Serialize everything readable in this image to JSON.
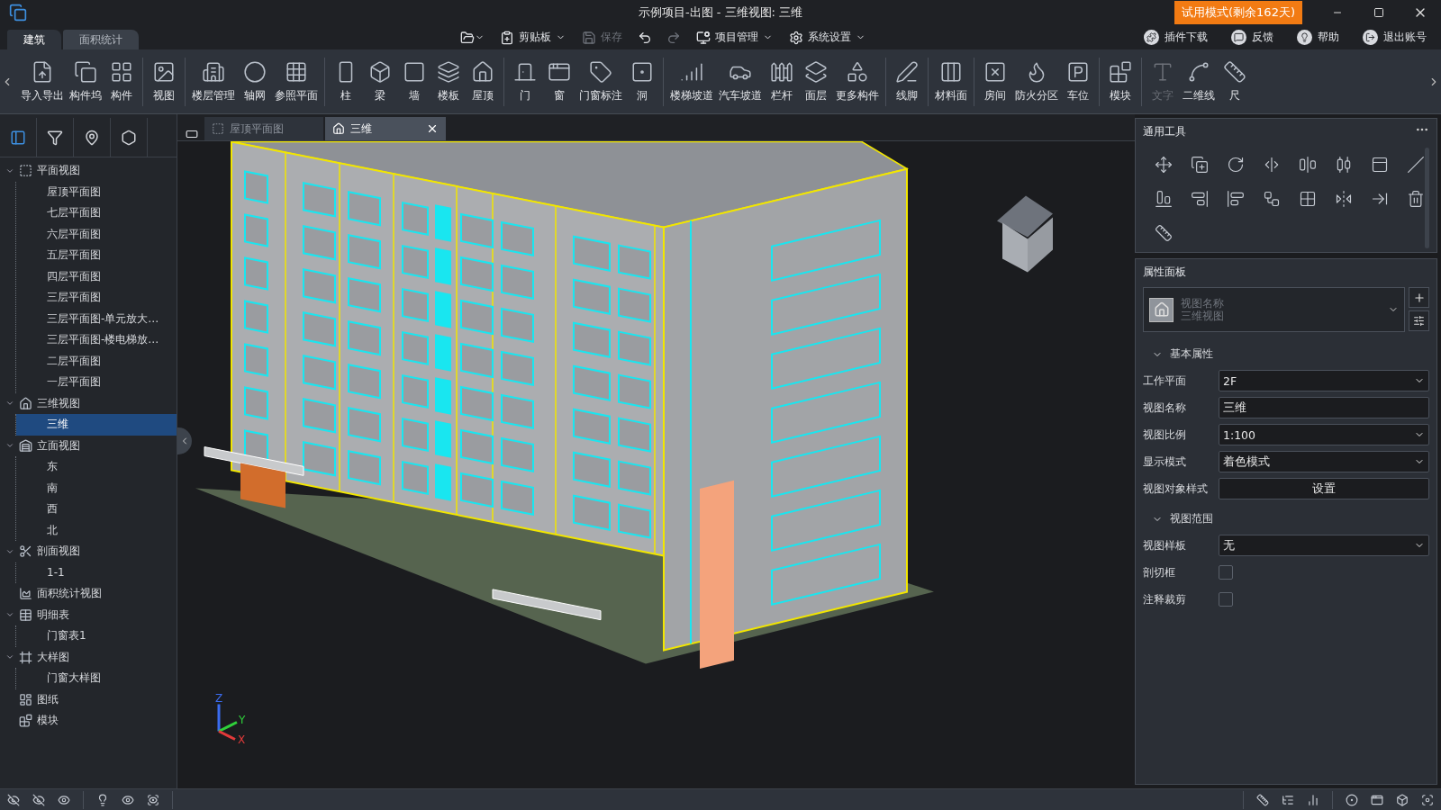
{
  "title_bar": {
    "title": "示例项目-出图 - 三维视图: 三维",
    "trial_badge": "试用模式(剩余162天)"
  },
  "ribbon_tabs": [
    {
      "label": "建筑",
      "selected": true
    },
    {
      "label": "面积统计",
      "selected": false
    }
  ],
  "quick_menu": [
    {
      "label": "剪贴板",
      "disabled": false
    },
    {
      "label": "保存",
      "disabled": true
    },
    {
      "label": "项目管理",
      "disabled": false
    },
    {
      "label": "系统设置",
      "disabled": false
    }
  ],
  "account_menu": [
    "插件下载",
    "反馈",
    "帮助",
    "退出账号"
  ],
  "toolbar_groups": [
    [
      {
        "label": "导入导出",
        "disabled": false
      },
      {
        "label": "构件坞",
        "disabled": false
      },
      {
        "label": "构件",
        "disabled": false
      }
    ],
    [
      {
        "label": "视图",
        "disabled": false
      }
    ],
    [
      {
        "label": "楼层管理",
        "disabled": false
      },
      {
        "label": "轴网",
        "disabled": false
      },
      {
        "label": "参照平面",
        "disabled": false
      }
    ],
    [
      {
        "label": "柱",
        "disabled": false
      },
      {
        "label": "梁",
        "disabled": false
      },
      {
        "label": "墙",
        "disabled": false
      },
      {
        "label": "楼板",
        "disabled": false
      },
      {
        "label": "屋顶",
        "disabled": false
      }
    ],
    [
      {
        "label": "门",
        "disabled": false
      },
      {
        "label": "窗",
        "disabled": false
      },
      {
        "label": "门窗标注",
        "disabled": false
      },
      {
        "label": "洞",
        "disabled": false
      }
    ],
    [
      {
        "label": "楼梯坡道",
        "disabled": false
      },
      {
        "label": "汽车坡道",
        "disabled": false
      },
      {
        "label": "栏杆",
        "disabled": false
      },
      {
        "label": "面层",
        "disabled": false
      },
      {
        "label": "更多构件",
        "disabled": false
      }
    ],
    [
      {
        "label": "线脚",
        "disabled": false
      }
    ],
    [
      {
        "label": "材料面",
        "disabled": false
      }
    ],
    [
      {
        "label": "房间",
        "disabled": false
      },
      {
        "label": "防火分区",
        "disabled": false
      },
      {
        "label": "车位",
        "disabled": false
      }
    ],
    [
      {
        "label": "模块",
        "disabled": false
      }
    ],
    [
      {
        "label": "文字",
        "disabled": true
      },
      {
        "label": "二维线",
        "disabled": false
      },
      {
        "label": "尺",
        "disabled": false
      }
    ]
  ],
  "view_tabs": [
    {
      "label": "屋顶平面图",
      "selected": false
    },
    {
      "label": "三维",
      "selected": true
    }
  ],
  "project_tree": [
    {
      "label": "平面视图",
      "selected": false,
      "expanded": true,
      "children": [
        {
          "label": "屋顶平面图",
          "selected": false
        },
        {
          "label": "七层平面图",
          "selected": false
        },
        {
          "label": "六层平面图",
          "selected": false
        },
        {
          "label": "五层平面图",
          "selected": false
        },
        {
          "label": "四层平面图",
          "selected": false
        },
        {
          "label": "三层平面图",
          "selected": false
        },
        {
          "label": "三层平面图-单元放大…",
          "selected": false
        },
        {
          "label": "三层平面图-楼电梯放…",
          "selected": false
        },
        {
          "label": "二层平面图",
          "selected": false
        },
        {
          "label": "一层平面图",
          "selected": false
        }
      ]
    },
    {
      "label": "三维视图",
      "selected": false,
      "expanded": true,
      "children": [
        {
          "label": "三维",
          "selected": true
        }
      ]
    },
    {
      "label": "立面视图",
      "selected": false,
      "expanded": true,
      "children": [
        {
          "label": "东",
          "selected": false
        },
        {
          "label": "南",
          "selected": false
        },
        {
          "label": "西",
          "selected": false
        },
        {
          "label": "北",
          "selected": false
        }
      ]
    },
    {
      "label": "剖面视图",
      "selected": false,
      "expanded": true,
      "children": [
        {
          "label": "1-1",
          "selected": false
        }
      ]
    },
    {
      "label": "面积统计视图",
      "selected": false
    },
    {
      "label": "明细表",
      "selected": false,
      "expanded": true,
      "children": [
        {
          "label": "门窗表1",
          "selected": false
        }
      ]
    },
    {
      "label": "大样图",
      "selected": false,
      "expanded": true,
      "children": [
        {
          "label": "门窗大样图",
          "selected": false
        }
      ]
    },
    {
      "label": "图纸",
      "selected": false
    },
    {
      "label": "模块",
      "selected": false
    }
  ],
  "canvas": {
    "axis_labels": [
      "Z",
      "Y",
      "X"
    ]
  },
  "general_tools": {
    "title": "通用工具"
  },
  "property_panel": {
    "title": "属性面板",
    "view_type": {
      "label": "视图名称",
      "value": "三维视图"
    },
    "sections": [
      {
        "title": "基本属性",
        "expanded": true,
        "rows": [
          {
            "label": "工作平面",
            "kind": "select",
            "value": "2F"
          },
          {
            "label": "视图名称",
            "kind": "text",
            "value": "三维"
          },
          {
            "label": "视图比例",
            "kind": "select",
            "value": "1:100"
          },
          {
            "label": "显示模式",
            "kind": "select",
            "value": "着色模式"
          },
          {
            "label": "视图对象样式",
            "kind": "button",
            "value": "设置"
          }
        ]
      },
      {
        "title": "视图范围",
        "expanded": true,
        "rows": [
          {
            "label": "视图样板",
            "kind": "select",
            "value": "无"
          },
          {
            "label": "剖切框",
            "kind": "checkbox",
            "checked": false
          },
          {
            "label": "注释裁剪",
            "kind": "checkbox",
            "checked": false
          }
        ]
      }
    ]
  }
}
